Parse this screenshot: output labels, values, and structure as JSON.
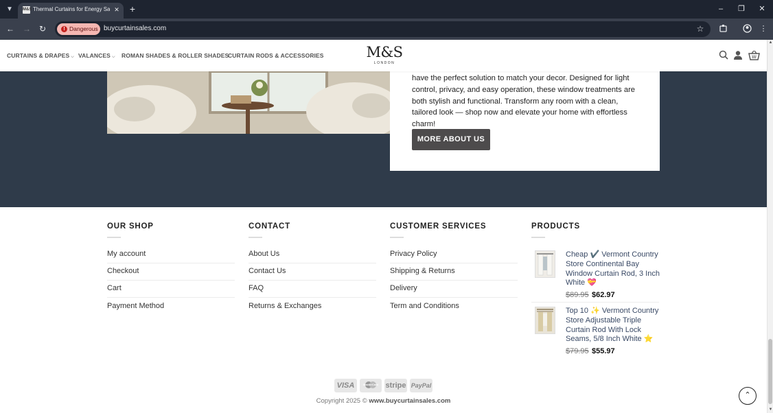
{
  "browser": {
    "tab_title": "Thermal Curtains for Energy Sav",
    "tab_favicon": "M&S",
    "security_label": "Dangerous",
    "url": "buycurtainsales.com",
    "icons": {
      "tab_menu": "chevron-down-icon",
      "close": "close-icon",
      "new_tab": "plus-icon",
      "back": "arrow-left-icon",
      "forward": "arrow-right-icon",
      "reload": "reload-icon",
      "bookmark": "star-icon",
      "extensions": "puzzle-icon",
      "profile": "account-icon",
      "menu": "kebab-icon"
    }
  },
  "header": {
    "nav": [
      {
        "label": "CURTAINS & DRAPES",
        "has_dropdown": true
      },
      {
        "label": "VALANCES",
        "has_dropdown": true
      },
      {
        "label": "ROMAN SHADES & ROLLER SHADES",
        "has_dropdown": false
      },
      {
        "label": "CURTAIN RODS & ACCESSORIES",
        "has_dropdown": false
      }
    ],
    "logo_main": "M&S",
    "logo_sub": "LONDON",
    "icons": [
      "search-icon",
      "account-icon",
      "basket-icon"
    ]
  },
  "about": {
    "text": "have the perfect solution to match your decor. Designed for light control, privacy, and easy operation, these window treatments are both stylish and functional. Transform any room with a clean, tailored look — shop now and elevate your home with effortless charm!",
    "button_label": "MORE ABOUT US"
  },
  "footer": {
    "columns": [
      {
        "title": "OUR SHOP",
        "links": [
          "My account",
          "Checkout",
          "Cart",
          "Payment Method"
        ]
      },
      {
        "title": "CONTACT",
        "links": [
          "About Us",
          "Contact Us",
          "FAQ",
          "Returns & Exchanges"
        ]
      },
      {
        "title": "CUSTOMER SERVICES",
        "links": [
          "Privacy Policy",
          "Shipping & Returns",
          "Delivery",
          "Term and Conditions"
        ]
      }
    ],
    "products_title": "PRODUCTS",
    "products": [
      {
        "name_prefix": "Cheap",
        "emoji1": "✔️",
        "name": "Vermont Country Store Continental Bay Window Curtain Rod, 3 Inch White",
        "emoji2": "💝",
        "old_price": "$89.95",
        "price": "$62.97"
      },
      {
        "name_prefix": "Top 10",
        "emoji1": "✨",
        "name": "Vermont Country Store Adjustable Triple Curtain Rod With Lock Seams, 5/8 Inch White",
        "emoji2": "⭐",
        "old_price": "$79.95",
        "price": "$55.97"
      }
    ],
    "payment_methods": [
      "VISA",
      "MasterCard",
      "stripe",
      "PayPal"
    ],
    "copyright_prefix": "Copyright 2025 ©",
    "copyright_site": "www.buycurtainsales.com"
  },
  "colors": {
    "dark_band": "#2f3b4a",
    "button": "#4d4b4c",
    "product_link": "#3a4a66",
    "danger": "#c5221f"
  }
}
